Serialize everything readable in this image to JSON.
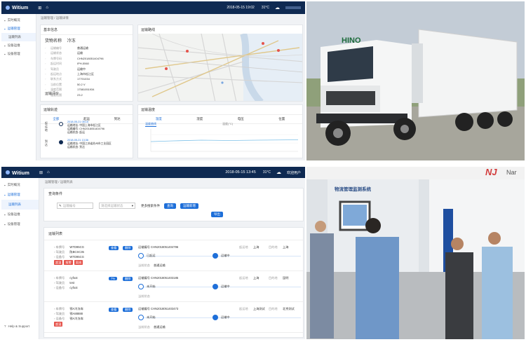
{
  "top_app": {
    "brand": "Witium",
    "datetime": "2018-05-15 19:02",
    "temperature": "31°C",
    "sidebar": [
      "实时概况",
      "运输管理",
      "运输列表",
      "设备运维",
      "设备管理"
    ],
    "breadcrumb": "运输管理 / 运输详情",
    "info_card": {
      "title": "基本信息",
      "subtitle": "货物名称",
      "subtitle_value": "冷冻",
      "rows": [
        {
          "label": "运输编号",
          "value": "普通运输"
        },
        {
          "label": "运输状态",
          "value": "运输"
        },
        {
          "label": "车牌号码",
          "value": "CHN2018051404796"
        },
        {
          "label": "起运时间",
          "value": "IPH-5560"
        },
        {
          "label": "驾驶员",
          "value": "运输中"
        },
        {
          "label": "起运地点",
          "value": "上海市松江区"
        },
        {
          "label": "联系方式",
          "value": "17701034"
        },
        {
          "label": "当前位置",
          "value": "50.2 V"
        },
        {
          "label": "温度范围",
          "value": "17581051934"
        },
        {
          "label": "湿度范围",
          "value": "23.2"
        }
      ],
      "footer": "运输评价"
    },
    "map_card": {
      "title": "运输路线"
    },
    "track_card": {
      "title": "运输轨迹",
      "tabs": [
        "全部",
        "起运",
        "到达"
      ],
      "events": [
        {
          "label": "起运地",
          "time": "2018-05-21 08:15",
          "lines": [
            "运输地址: 中国上海市松江区",
            "运输编号: CHN2018051404796",
            "运输状态: 起运"
          ]
        },
        {
          "label": "到达",
          "time": "2018-05-21 13:36",
          "lines": [
            "运输地址: 中国江苏省苏州市工业园区",
            "运输状态: 到达"
          ]
        }
      ]
    },
    "chart_card": {
      "title": "运输温度",
      "tabs": [
        "温度",
        "湿度",
        "电压",
        "位置"
      ],
      "active_tab": "温度曲线",
      "legend": "温度(°C)"
    }
  },
  "bottom_app": {
    "brand": "Witium",
    "datetime": "2018-05-15 13:45",
    "temperature": "31°C",
    "user": "欢迎用户",
    "sidebar": [
      "实时概况",
      "运输管理",
      "运输列表",
      "设备运维",
      "设备管理"
    ],
    "help": "Help & Support",
    "breadcrumb": "运输管理 / 运输列表",
    "query_title": "查询条件",
    "query_placeholder": "运输编号",
    "query_select": "请选择运输状态",
    "query_more": "更多搜索条件",
    "btn_search": "查询",
    "btn_new": "运输新增",
    "btn_export": "导出",
    "list_title": "运输列表",
    "rows": [
      {
        "plate": "WTD95CG",
        "driver": "陈BCSC35",
        "device": "WTD95CG",
        "btn1": "查看",
        "btn2": "删除",
        "badges": [
          "超温",
          "报警",
          "离线"
        ],
        "code": "运输编号 CHN2018051404796",
        "from_label": "起运地",
        "from": "上海",
        "to_label": "目的地",
        "to": "上海",
        "step1": "已起运",
        "step2": "运输中",
        "status": "当前状态",
        "status_val": "普通运输"
      },
      {
        "plate": "cyfoot",
        "driver": "test",
        "device": "cyfoot",
        "btn1": "7%",
        "btn2": "删除",
        "badges": [],
        "code": "运输编号 CHN2018051403185",
        "from_label": "起运地",
        "from": "上海",
        "to_label": "目的地",
        "to": "昆明",
        "step1": "未开始",
        "step2": "运输中",
        "status": "当前状态",
        "status_val": ""
      },
      {
        "plate": "鄂A冷冻车",
        "driver": "鄂A88888",
        "device": "鄂A冷冻车",
        "btn1": "查看",
        "btn2": "删除",
        "badges": [
          "超温"
        ],
        "code": "运输编号 CHN2018051403473",
        "from_label": "起运地",
        "from": "上海测试",
        "to_label": "目的地",
        "to": "北京测试",
        "step1": "未开始",
        "step2": "运输中",
        "status": "当前状态",
        "status_val": "普通运输"
      }
    ]
  },
  "truck_photo": {
    "cab_brand": "HINO"
  },
  "expo_photo": {
    "banner": "物流管理监测系统",
    "booth_logo": "NJ",
    "booth_text": "Nar"
  },
  "colors": {
    "nav": "#0f2a52",
    "accent": "#1e6fd9",
    "danger": "#e5534b"
  }
}
